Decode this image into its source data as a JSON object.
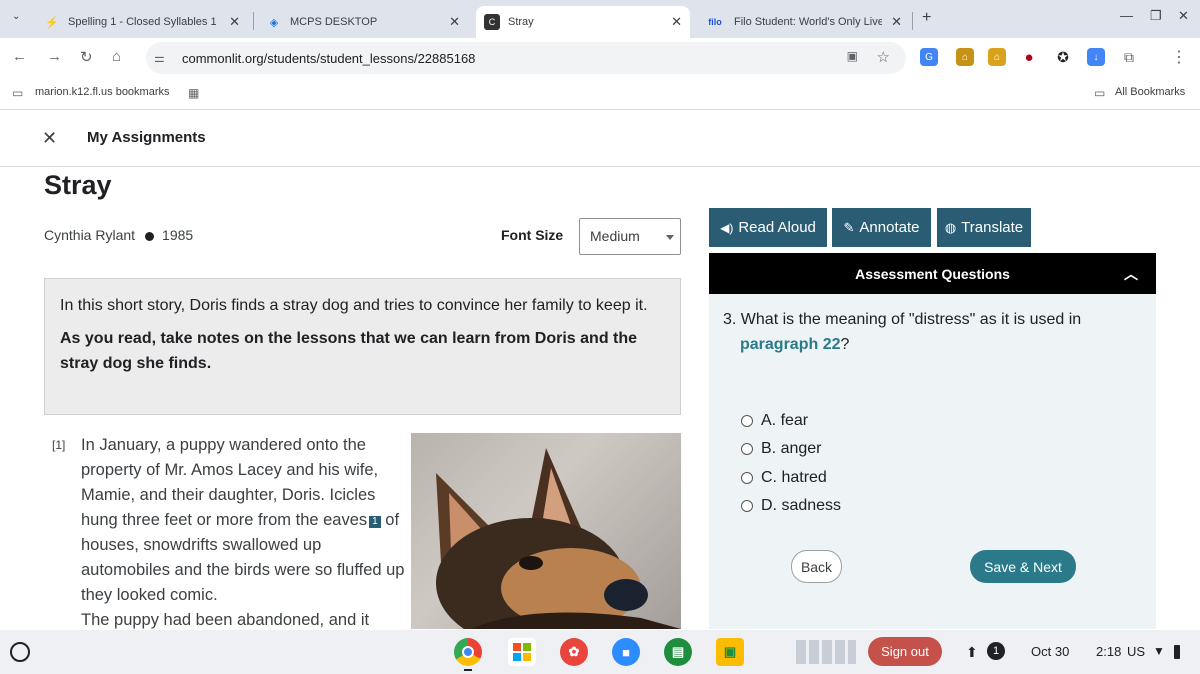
{
  "tabs": [
    {
      "title": "Spelling 1 - Closed Syllables 1 -",
      "icon": "quizlet-bolt-icon"
    },
    {
      "title": "MCPS DESKTOP",
      "icon": "desktop-icon"
    },
    {
      "title": "Stray",
      "icon": "commonlit-icon"
    },
    {
      "title": "Filo Student: World's Only Live I",
      "icon": "filo-icon",
      "icon_text": "filo"
    }
  ],
  "toolbar": {
    "url": "commonlit.org/students/student_lessons/22885168"
  },
  "bookmarks": {
    "folder": "marion.k12.fl.us bookmarks",
    "all": "All Bookmarks"
  },
  "header": {
    "nav_title": "My Assignments",
    "story_title": "Stray",
    "author": "Cynthia Rylant",
    "year": "1985",
    "font_size_label": "Font Size",
    "font_size_value": "Medium"
  },
  "intro": {
    "summary": "In this short story, Doris finds a stray dog and tries to convince her family to keep it.",
    "instruction": "As you read, take notes on the lessons that we can learn from Doris and the stray dog she finds."
  },
  "paragraph": {
    "number": "[1]",
    "text_part1": "In January, a puppy wandered onto the property of Mr. Amos Lacey and his wife, Mamie, and their daughter, Doris. Icicles hung three feet or more from the eaves",
    "footnote": "1",
    "text_part2": " of houses, snowdrifts swallowed up automobiles and the birds were so fluffed up they looked comic.",
    "text_part3": "The puppy had been abandoned, and it"
  },
  "tools": {
    "read_aloud": "Read Aloud",
    "annotate": "Annotate",
    "translate": "Translate"
  },
  "assessment": {
    "heading": "Assessment Questions",
    "question_prefix": "3. What is the meaning of \"distress\" as it is used in",
    "question_link": "paragraph 22",
    "question_suffix": "?",
    "options": [
      "A. fear",
      "B. anger",
      "C. hatred",
      "D. sadness"
    ],
    "back_label": "Back",
    "save_label": "Save & Next"
  },
  "shelf": {
    "sign_out": "Sign out",
    "notification_count": "1",
    "date": "Oct 30",
    "time": "2:18",
    "locale": "US"
  },
  "colors": {
    "accent": "#2a7a8a",
    "tool_bg": "#2a5d74",
    "sign_out": "#c5524a"
  }
}
